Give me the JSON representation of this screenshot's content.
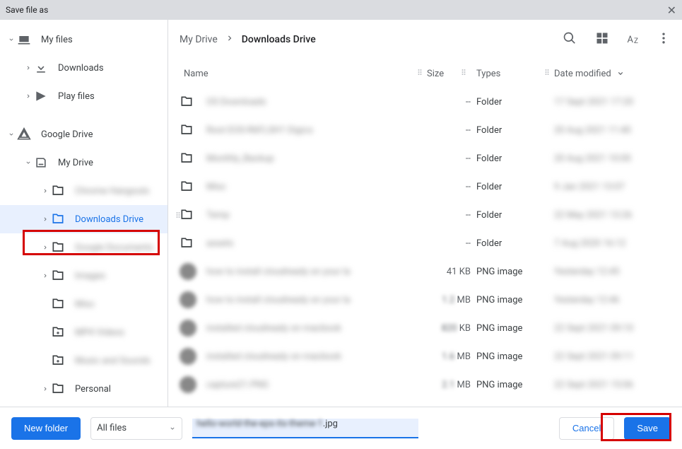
{
  "title": "Save file as",
  "sidebar": {
    "roots": [
      {
        "label": "My files",
        "icon": "laptop"
      },
      {
        "label": "Downloads",
        "icon": "download",
        "indent": 1
      },
      {
        "label": "Play files",
        "icon": "play",
        "indent": 1
      }
    ],
    "drive_root": {
      "label": "Google Drive",
      "icon": "drive"
    },
    "mydrive": {
      "label": "My Drive",
      "icon": "hdd"
    },
    "mydrive_children": [
      {
        "label": "Chrome Hangouts",
        "blurred": true,
        "icon": "folder",
        "expander": true
      },
      {
        "label": "Downloads Drive",
        "blurred": false,
        "icon": "folder",
        "selected": true,
        "expander": true
      },
      {
        "label": "Google Documents",
        "blurred": true,
        "icon": "folder",
        "expander": true
      },
      {
        "label": "Images",
        "blurred": true,
        "icon": "folder",
        "expander": true
      },
      {
        "label": "Misc",
        "blurred": true,
        "icon": "folder",
        "expander": false
      },
      {
        "label": "MP4 Videos",
        "blurred": true,
        "icon": "shared-folder",
        "expander": false
      },
      {
        "label": "Music and Sounds",
        "blurred": true,
        "icon": "shared-folder",
        "expander": false
      },
      {
        "label": "Personal",
        "blurred": false,
        "icon": "folder",
        "expander": true
      }
    ]
  },
  "breadcrumb": [
    "My Drive",
    "Downloads Drive"
  ],
  "columns": {
    "name": "Name",
    "size": "Size",
    "types": "Types",
    "date": "Date modified"
  },
  "files": [
    {
      "kind": "folder",
      "name": "OS Downloads",
      "size": "--",
      "type": "Folder",
      "date": "17 Sept 2021 17:20",
      "blurred": true
    },
    {
      "kind": "folder",
      "name": "Root EOS-R6FLSH1 Digics",
      "size": "--",
      "type": "Folder",
      "date": "20 Aug 2021 11:40",
      "blurred": true
    },
    {
      "kind": "folder",
      "name": "Monthly_Backup",
      "size": "--",
      "type": "Folder",
      "date": "20 Aug 2021 10:00",
      "blurred": true
    },
    {
      "kind": "folder",
      "name": "Misc",
      "size": "--",
      "type": "Folder",
      "date": "9 Jan 2021 13:07",
      "blurred": true
    },
    {
      "kind": "folder",
      "name": "Temp",
      "size": "--",
      "type": "Folder",
      "date": "22 May 2021 13:26",
      "blurred": true
    },
    {
      "kind": "folder",
      "name": "assets",
      "size": "--",
      "type": "Folder",
      "date": "7 Aug 2020 16:12",
      "blurred": true
    },
    {
      "kind": "img",
      "name": "how to install cloudready on your la",
      "size": "41 KB",
      "sizeunit": "",
      "type": "PNG image",
      "date": "Yesterday 12:45",
      "blurred": true
    },
    {
      "kind": "img",
      "name": "how to install cloudready on your la",
      "size": "1.2",
      "sizeunit": "MB",
      "type": "PNG image",
      "date": "Yesterday 12:46",
      "blurred": true
    },
    {
      "kind": "img",
      "name": "installed cloudready on macbook",
      "size": "820",
      "sizeunit": "KB",
      "type": "PNG image",
      "date": "22 Sept 2021 09:10",
      "blurred": true
    },
    {
      "kind": "img",
      "name": "installed cloudready on macbook",
      "size": "1.6",
      "sizeunit": "MB",
      "type": "PNG image",
      "date": "22 Sept 2021 09:11",
      "blurred": true
    },
    {
      "kind": "img",
      "name": "capture21.PNG",
      "size": "2.1",
      "sizeunit": "MB",
      "type": "PNG image",
      "date": "22 Sept 2021 15:06",
      "blurred": true
    }
  ],
  "footer": {
    "new_folder": "New folder",
    "filter": "All files",
    "filename_blurred": "hello-world-the-eps-its-theme-1",
    "filename_ext": ".jpg",
    "cancel": "Cancel",
    "save": "Save"
  }
}
